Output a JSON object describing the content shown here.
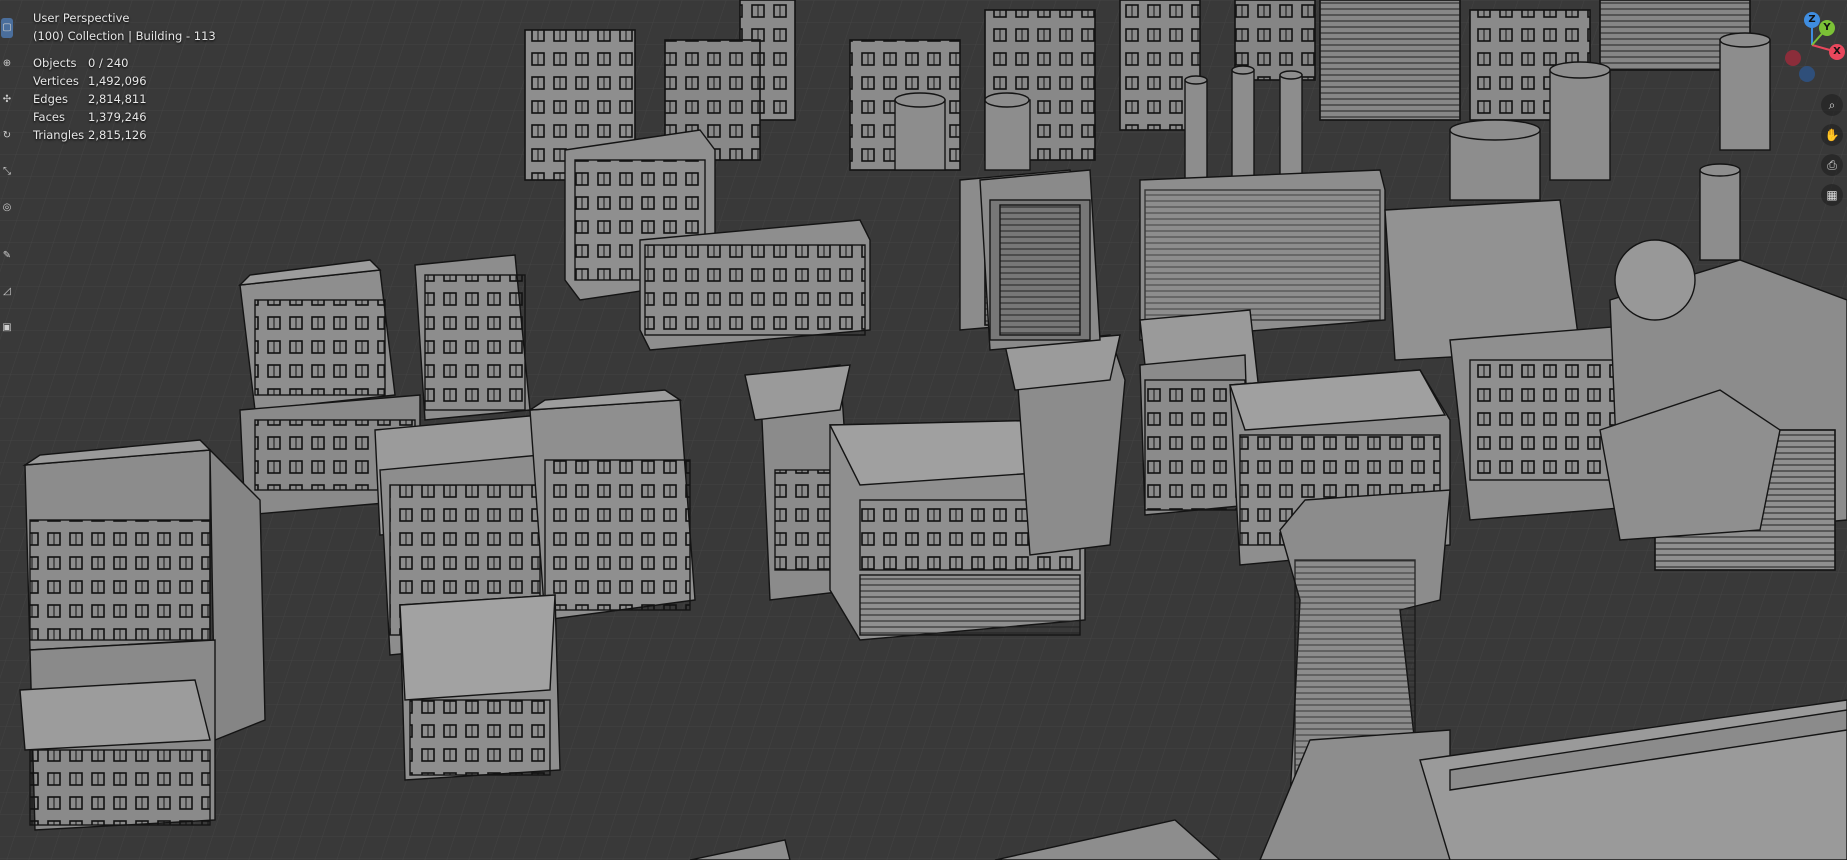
{
  "viewport": {
    "view_name": "User Perspective",
    "collection_line": "(100) Collection | Building - 113"
  },
  "stats": [
    {
      "label": "Objects",
      "value": "0 / 240"
    },
    {
      "label": "Vertices",
      "value": "1,492,096"
    },
    {
      "label": "Edges",
      "value": "2,814,811"
    },
    {
      "label": "Faces",
      "value": "1,379,246"
    },
    {
      "label": "Triangles",
      "value": "2,815,126"
    }
  ],
  "toolbar": {
    "tools": [
      "select-box-icon",
      "cursor-icon",
      "move-icon",
      "rotate-icon",
      "scale-icon",
      "transform-icon",
      "annotate-icon",
      "measure-icon",
      "add-cube-icon"
    ]
  },
  "gizmo": {
    "x_label": "X",
    "y_label": "Y",
    "z_label": "Z",
    "colors": {
      "x": "#e8475c",
      "y": "#7bc136",
      "z": "#3f8de0"
    }
  },
  "nav_buttons": [
    "zoom-icon",
    "pan-hand-icon",
    "camera-icon",
    "grid-view-icon"
  ],
  "colors": {
    "background": "#393939",
    "grid": "#444444",
    "building": "#8e8e8e",
    "building_top": "#9a9a9a",
    "line": "#141414"
  }
}
